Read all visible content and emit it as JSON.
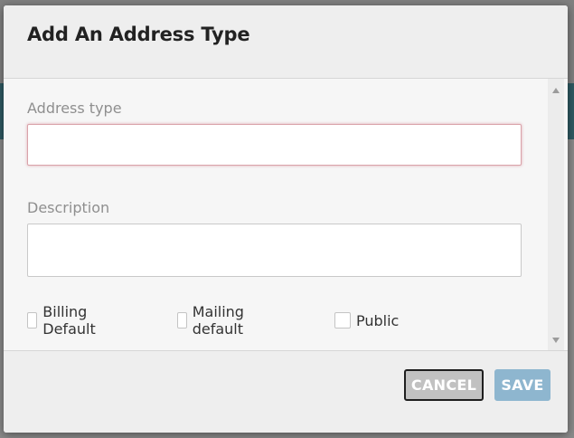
{
  "dialog": {
    "title": "Add An Address Type"
  },
  "form": {
    "address_type": {
      "label": "Address type",
      "value": ""
    },
    "description": {
      "label": "Description",
      "value": ""
    },
    "checkboxes": [
      {
        "label": "Billing Default",
        "checked": false
      },
      {
        "label": "Mailing default",
        "checked": false
      },
      {
        "label": "Public",
        "checked": false
      }
    ]
  },
  "footer": {
    "cancel_label": "CANCEL",
    "save_label": "SAVE"
  },
  "colors": {
    "save_button": "#8eb6cf",
    "cancel_button": "#c1c1c1",
    "input_focus_border": "#d9a3aa"
  }
}
